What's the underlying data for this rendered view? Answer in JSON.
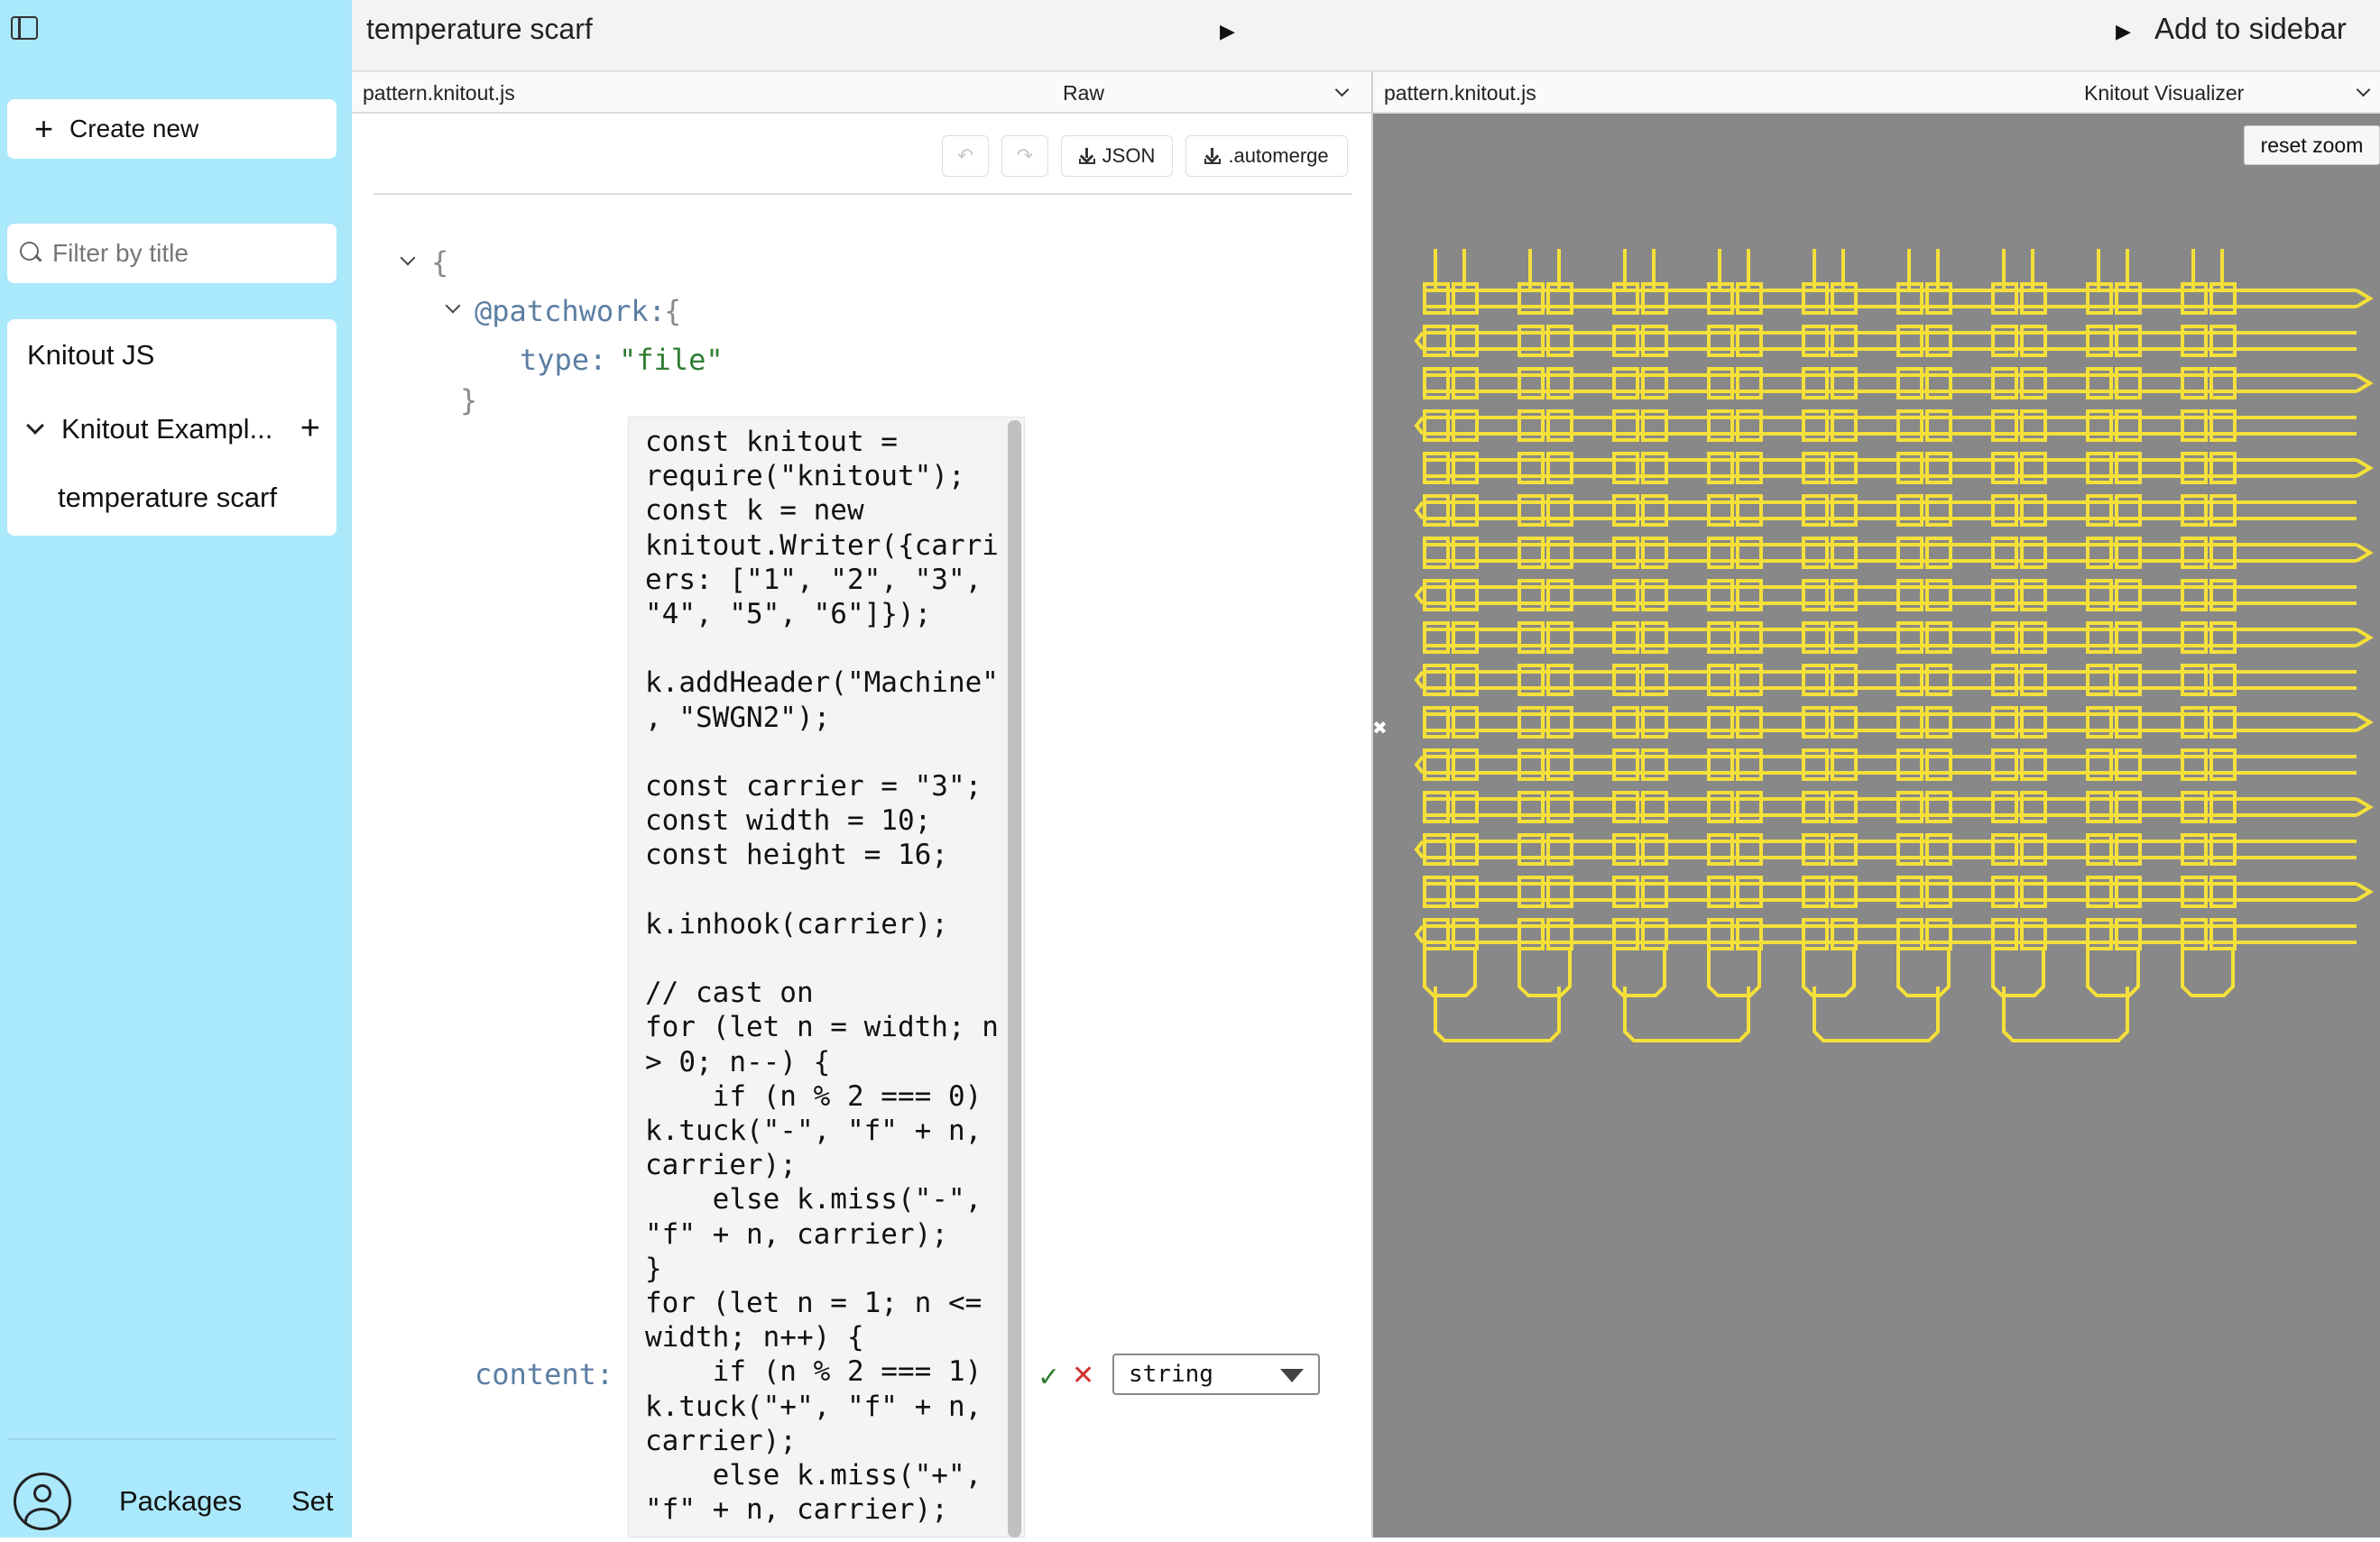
{
  "sidebar": {
    "create_label": "Create new",
    "filter_placeholder": "Filter by title",
    "tree_title": "Knitout JS",
    "folder_label": "Knitout Exampl...",
    "doc_label": "temperature scarf",
    "packages_label": "Packages",
    "settings_label": "Set"
  },
  "topbar": {
    "doc_title": "temperature scarf",
    "add_sidebar_label": "Add to sidebar"
  },
  "left_pane": {
    "file_name": "pattern.knitout.js",
    "mode": "Raw",
    "json_button": "JSON",
    "automerge_button": ".automerge"
  },
  "right_pane": {
    "file_name": "pattern.knitout.js",
    "mode": "Knitout Visualizer",
    "reset_zoom": "reset zoom",
    "yarn_color": "#f5e03a",
    "background_color": "#888888"
  },
  "json_view": {
    "open_brace": "{",
    "patchwork_key": "@patchwork:",
    "patchwork_brace": "{",
    "type_key": "type:",
    "type_value": "\"file\"",
    "close_brace": "}",
    "content_key": "content:",
    "content_type": "string",
    "code": "const knitout =\nrequire(\"knitout\");\nconst k = new\nknitout.Writer({carri\ners: [\"1\", \"2\", \"3\",\n\"4\", \"5\", \"6\"]});\n\nk.addHeader(\"Machine\"\n, \"SWGN2\");\n\nconst carrier = \"3\";\nconst width = 10;\nconst height = 16;\n\nk.inhook(carrier);\n\n// cast on\nfor (let n = width; n\n> 0; n--) {\n    if (n % 2 === 0)\nk.tuck(\"-\", \"f\" + n,\ncarrier);\n    else k.miss(\"-\",\n\"f\" + n, carrier);\n}\nfor (let n = 1; n <=\nwidth; n++) {\n    if (n % 2 === 1)\nk.tuck(\"+\", \"f\" + n,\ncarrier);\n    else k.miss(\"+\",\n\"f\" + n, carrier);"
  }
}
